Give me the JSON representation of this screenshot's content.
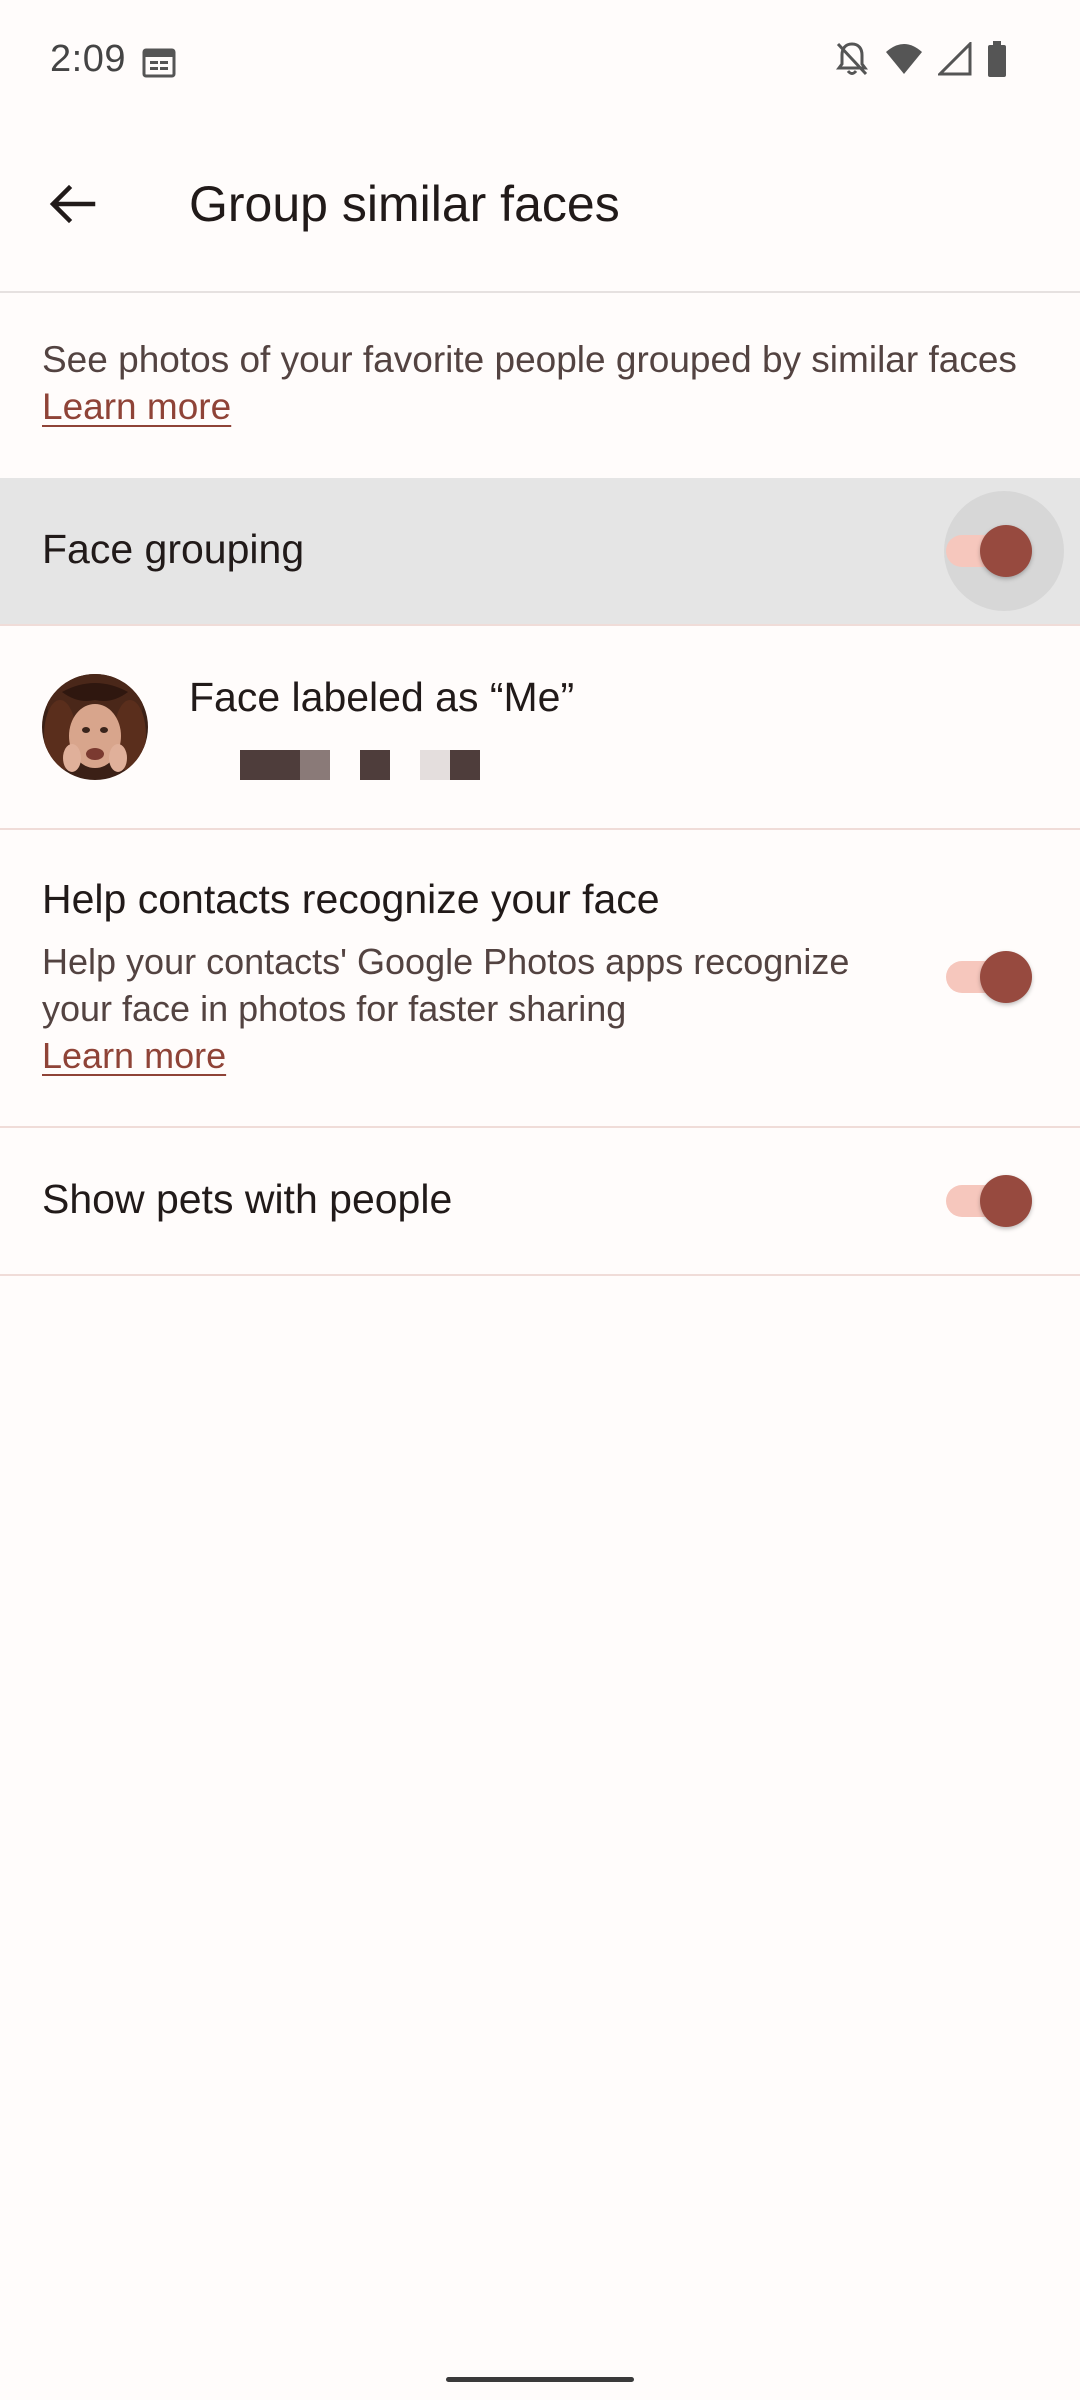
{
  "status_bar": {
    "time": "2:09",
    "icons": [
      "calendar-icon",
      "notifications-off-icon",
      "wifi-icon",
      "signal-icon",
      "battery-icon"
    ]
  },
  "app_bar": {
    "title": "Group similar faces",
    "back_icon": "arrow-back-icon"
  },
  "description": {
    "text": "See photos of your favorite people grouped by similar faces ",
    "link": "Learn more"
  },
  "settings": {
    "face_grouping": {
      "label": "Face grouping",
      "enabled": true
    },
    "face_me": {
      "label": "Face labeled as “Me”"
    },
    "help_contacts": {
      "title": "Help contacts recognize your face",
      "description": "Help your contacts' Google Photos apps recognize your face in photos for faster sharing",
      "link": "Learn more",
      "enabled": true
    },
    "pets": {
      "label": "Show pets with people",
      "enabled": true
    }
  },
  "colors": {
    "accent": "#974a3f",
    "track": "#f6c7bd",
    "link": "#8f4337"
  }
}
